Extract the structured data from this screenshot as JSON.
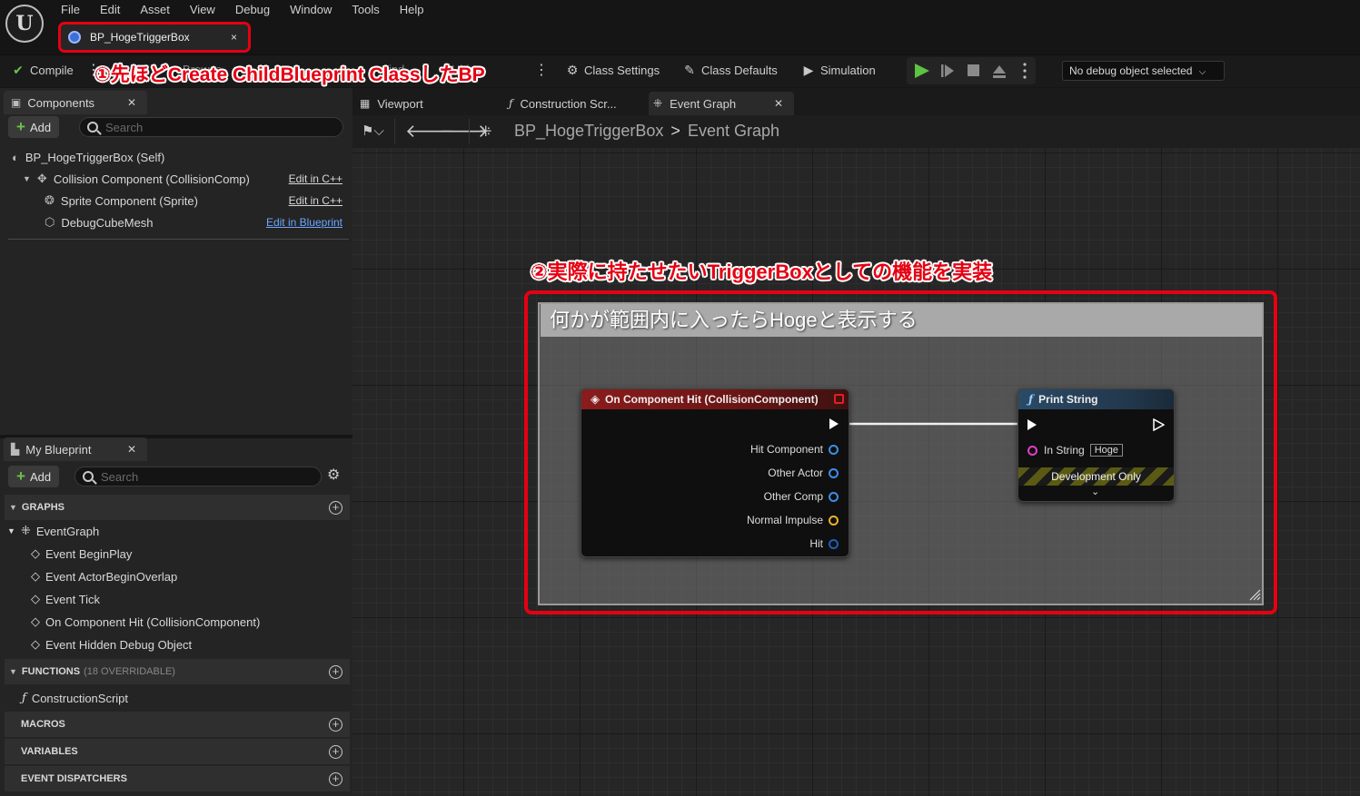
{
  "menu": [
    "File",
    "Edit",
    "Asset",
    "View",
    "Debug",
    "Window",
    "Tools",
    "Help"
  ],
  "logo_text": "U",
  "document_tab": {
    "label": "BP_HogeTriggerBox",
    "close": "×"
  },
  "toolbar": {
    "compile": "Compile",
    "browse": "Browse",
    "find": "Find",
    "hide": "Hide",
    "class_settings": "Class Settings",
    "class_defaults": "Class Defaults",
    "simulation": "Simulation",
    "debug_object": "No debug object selected"
  },
  "annotations": {
    "a1": "①先ほどCreate ChildBlueprint ClassしたBP",
    "a2": "②実際に持たせたいTriggerBoxとしての機能を実装"
  },
  "components_panel": {
    "tab": "Components",
    "add": "Add",
    "search_placeholder": "Search",
    "items": [
      {
        "label": "BP_HogeTriggerBox (Self)",
        "edit": ""
      },
      {
        "label": "Collision Component (CollisionComp)",
        "edit": "Edit in C++"
      },
      {
        "label": "Sprite Component (Sprite)",
        "edit": "Edit in C++"
      },
      {
        "label": "DebugCubeMesh",
        "edit": "Edit in Blueprint"
      }
    ]
  },
  "my_blueprint": {
    "tab": "My Blueprint",
    "add": "Add",
    "search_placeholder": "Search",
    "graphs_header": "GRAPHS",
    "event_graph": "EventGraph",
    "events": [
      "Event BeginPlay",
      "Event ActorBeginOverlap",
      "Event Tick",
      "On Component Hit (CollisionComponent)",
      "Event Hidden Debug Object"
    ],
    "functions_header": "FUNCTIONS",
    "functions_sub": "(18 OVERRIDABLE)",
    "construction_script": "ConstructionScript",
    "macros_header": "MACROS",
    "variables_header": "VARIABLES",
    "dispatchers_header": "EVENT DISPATCHERS"
  },
  "graph_tabs": [
    "Viewport",
    "Construction Scr...",
    "Event Graph"
  ],
  "breadcrumb": {
    "root": "BP_HogeTriggerBox",
    "separator": ">",
    "current": "Event Graph"
  },
  "comment_box": {
    "title": "何かが範囲内に入ったらHogeと表示する"
  },
  "event_node": {
    "title": "On Component Hit (CollisionComponent)",
    "pins": [
      "Hit Component",
      "Other Actor",
      "Other Comp",
      "Normal Impulse",
      "Hit"
    ]
  },
  "print_node": {
    "title": "Print String",
    "in_string_label": "In String",
    "in_string_value": "Hoge",
    "footer": "Development Only"
  },
  "colors": {
    "annotation_red": "#e50012",
    "event_header": "#8a1c1c",
    "function_header": "#2b4a66",
    "object_pin": "#3d8ee6",
    "vector_pin": "#e8b32a",
    "string_pin": "#e040c8",
    "accent_green": "#6bc24a"
  }
}
